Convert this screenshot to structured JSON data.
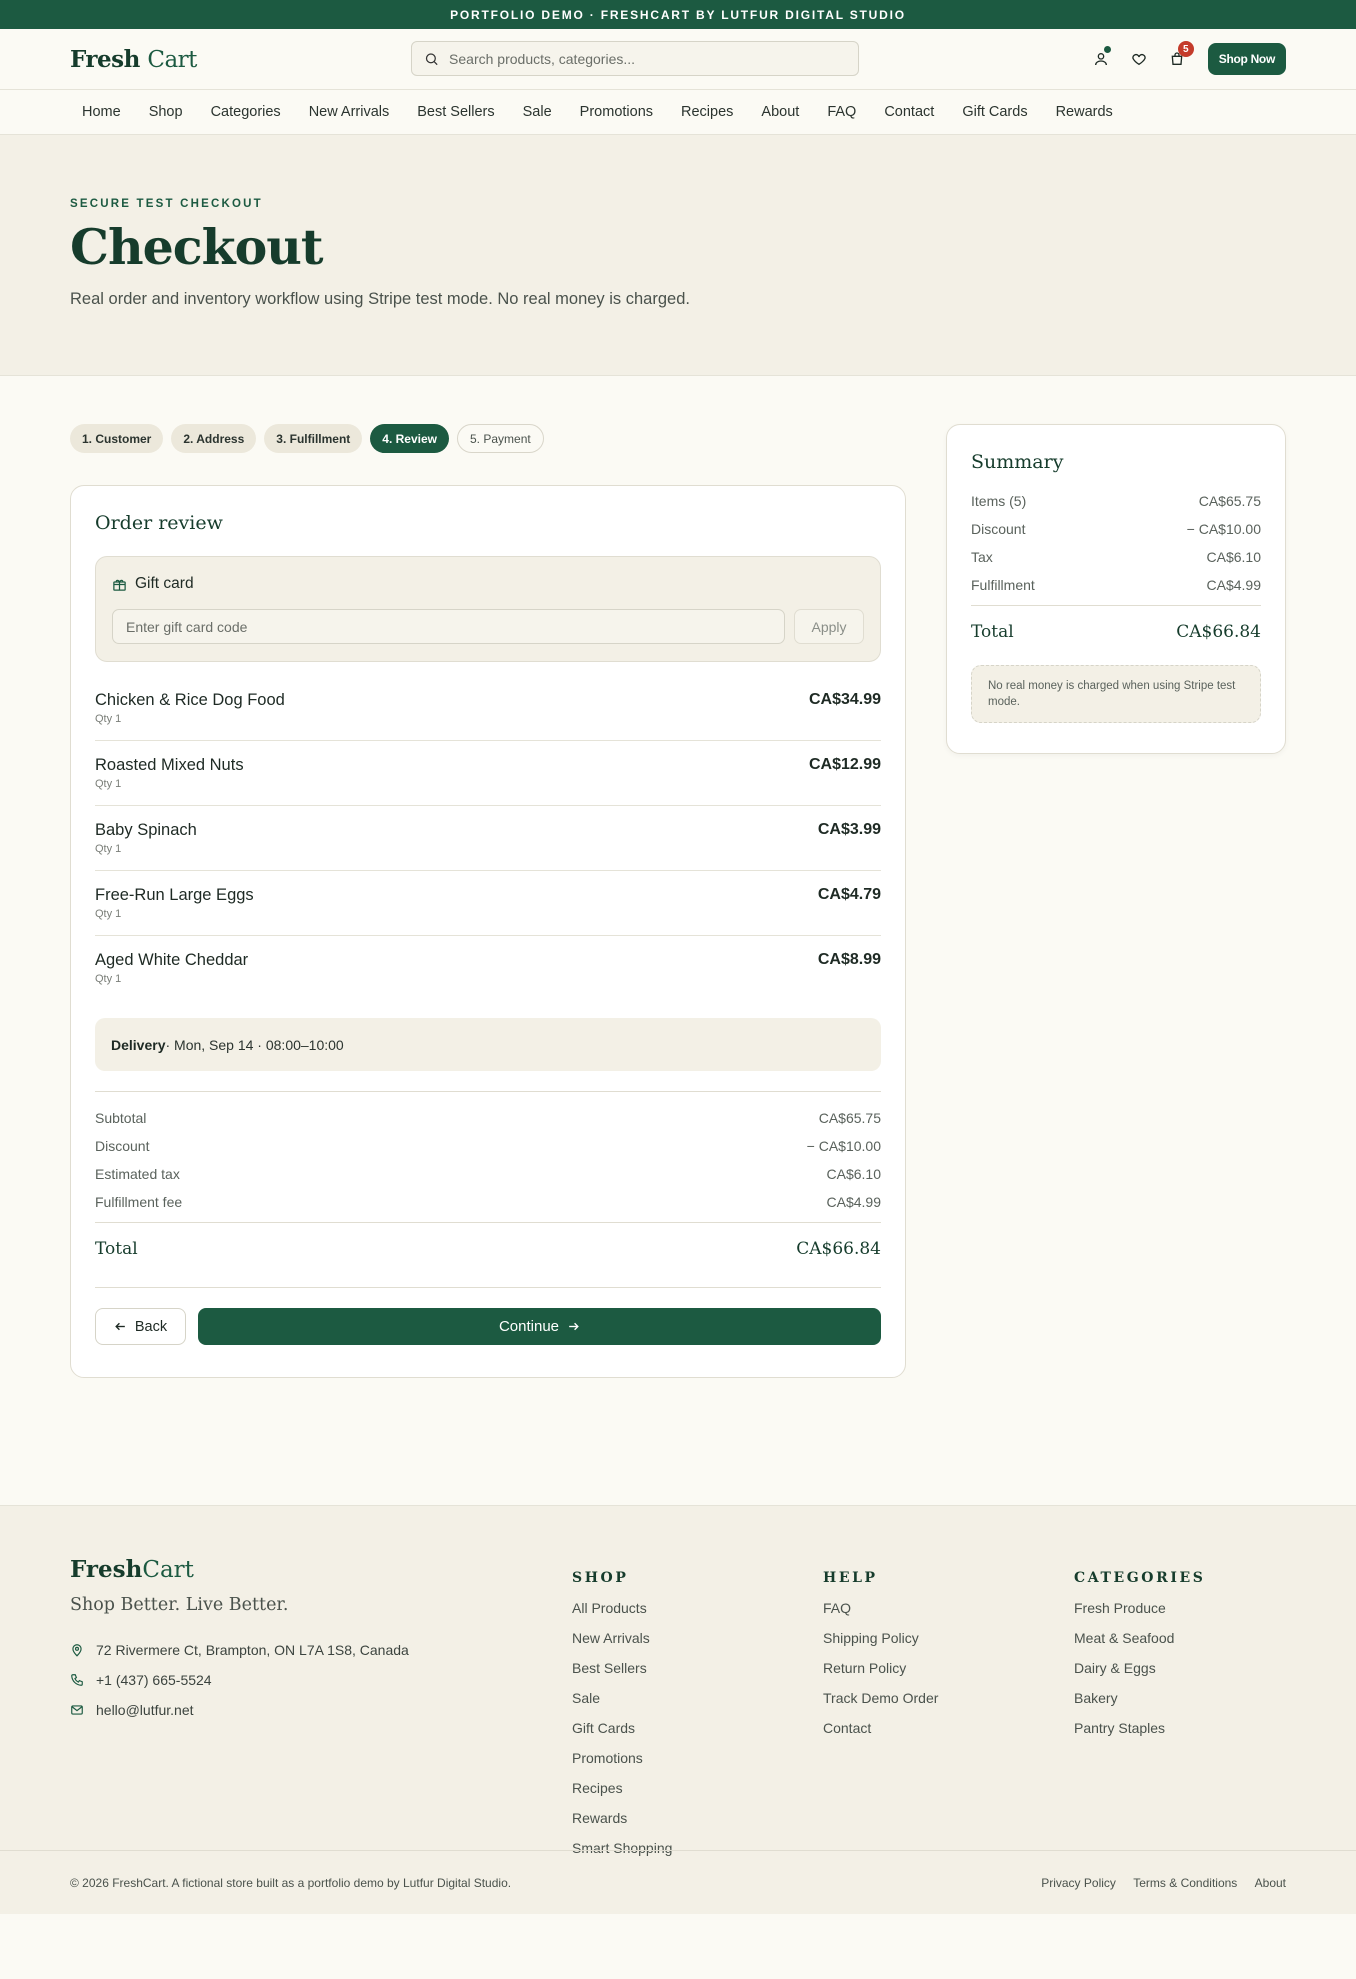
{
  "announcement": "PORTFOLIO DEMO · FRESHCART BY LUTFUR DIGITAL STUDIO",
  "header": {
    "logo_main": "Fresh",
    "logo_accent": "Cart",
    "search_placeholder": "Search products, categories...",
    "cart_count": "5",
    "shop_now": "Shop Now",
    "icons": [
      "user-icon",
      "heart-icon",
      "cart-icon"
    ]
  },
  "nav": [
    "Home",
    "Shop",
    "Categories",
    "New Arrivals",
    "Best Sellers",
    "Sale",
    "Promotions",
    "Recipes",
    "About",
    "FAQ",
    "Contact",
    "Gift Cards",
    "Rewards"
  ],
  "hero": {
    "eyebrow": "SECURE TEST CHECKOUT",
    "title": "Checkout",
    "subtitle": "Real order and inventory workflow using Stripe test mode. No real money is charged."
  },
  "steps": [
    {
      "label": "1. Customer",
      "state": "done"
    },
    {
      "label": "2. Address",
      "state": "done"
    },
    {
      "label": "3. Fulfillment",
      "state": "done"
    },
    {
      "label": "4. Review",
      "state": "active"
    },
    {
      "label": "5. Payment",
      "state": "future"
    }
  ],
  "review": {
    "title": "Order review",
    "gift_card": {
      "title": "Gift card",
      "placeholder": "Enter gift card code",
      "apply": "Apply"
    },
    "items": [
      {
        "name": "Chicken & Rice Dog Food",
        "qty": "Qty 1",
        "price": "CA$34.99"
      },
      {
        "name": "Roasted Mixed Nuts",
        "qty": "Qty 1",
        "price": "CA$12.99"
      },
      {
        "name": "Baby Spinach",
        "qty": "Qty 1",
        "price": "CA$3.99"
      },
      {
        "name": "Free-Run Large Eggs",
        "qty": "Qty 1",
        "price": "CA$4.79"
      },
      {
        "name": "Aged White Cheddar",
        "qty": "Qty 1",
        "price": "CA$8.99"
      }
    ],
    "delivery_label": "Delivery",
    "delivery_detail": " · Mon, Sep 14 · 08:00–10:00",
    "totals": [
      {
        "label": "Subtotal",
        "value": "CA$65.75"
      },
      {
        "label": "Discount",
        "value": "− CA$10.00"
      },
      {
        "label": "Estimated tax",
        "value": "CA$6.10"
      },
      {
        "label": "Fulfillment fee",
        "value": "CA$4.99"
      }
    ],
    "total_label": "Total",
    "total_value": "CA$66.84",
    "back": "Back",
    "continue": "Continue"
  },
  "summary": {
    "title": "Summary",
    "rows": [
      {
        "label": "Items (5)",
        "value": "CA$65.75"
      },
      {
        "label": "Discount",
        "value": "− CA$10.00"
      },
      {
        "label": "Tax",
        "value": "CA$6.10"
      },
      {
        "label": "Fulfillment",
        "value": "CA$4.99"
      }
    ],
    "total_label": "Total",
    "total_value": "CA$66.84",
    "note": "No real money is charged when using Stripe test mode."
  },
  "footer": {
    "logo_main": "Fresh",
    "logo_accent": "Cart",
    "tagline": "Shop Better. Live Better.",
    "address": "72 Rivermere Ct, Brampton, ON L7A 1S8, Canada",
    "phone": "+1 (437) 665-5524",
    "email": "hello@lutfur.net",
    "shop": {
      "title": "SHOP",
      "links": [
        "All Products",
        "New Arrivals",
        "Best Sellers",
        "Sale",
        "Gift Cards",
        "Promotions",
        "Recipes",
        "Rewards",
        "Smart Shopping"
      ]
    },
    "help": {
      "title": "HELP",
      "links": [
        "FAQ",
        "Shipping Policy",
        "Return Policy",
        "Track Demo Order",
        "Contact"
      ]
    },
    "categories": {
      "title": "CATEGORIES",
      "links": [
        "Fresh Produce",
        "Meat & Seafood",
        "Dairy & Eggs",
        "Bakery",
        "Pantry Staples"
      ]
    },
    "copyright": "© 2026 FreshCart. A fictional store built as a portfolio demo by Lutfur Digital Studio.",
    "legal": [
      "Privacy Policy",
      "Terms & Conditions",
      "About"
    ]
  },
  "colors": {
    "brand": "#1c5a41",
    "badge": "#c43b2a",
    "background": "#fbfaf4",
    "panel": "#f3f0e6"
  }
}
